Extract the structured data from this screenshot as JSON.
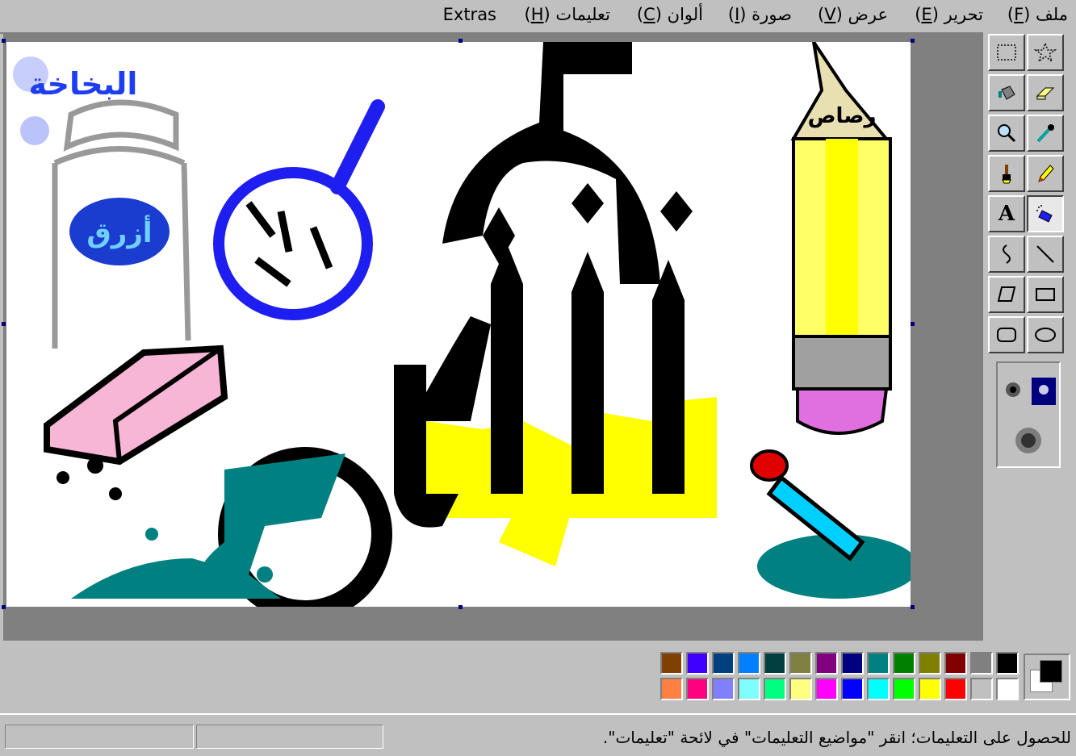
{
  "menubar": {
    "items": [
      {
        "label": "ملف",
        "mnemonic": "F"
      },
      {
        "label": "تحرير",
        "mnemonic": "E"
      },
      {
        "label": "عرض",
        "mnemonic": "V"
      },
      {
        "label": "صورة",
        "mnemonic": "I"
      },
      {
        "label": "ألوان",
        "mnemonic": "C"
      },
      {
        "label": "تعليمات",
        "mnemonic": "H"
      },
      {
        "label": "Extras",
        "mnemonic": ""
      }
    ]
  },
  "canvas": {
    "calligraphy": {
      "top_left": "البخاخة",
      "spray_can_label": "أزرق",
      "pencil_tip": "رصاص"
    }
  },
  "toolbox": {
    "tools": [
      {
        "name": "free-form-select",
        "icon": "star-select-icon"
      },
      {
        "name": "rect-select",
        "icon": "rect-select-icon"
      },
      {
        "name": "eraser",
        "icon": "eraser-icon"
      },
      {
        "name": "fill",
        "icon": "paint-bucket-icon"
      },
      {
        "name": "pick-color",
        "icon": "eyedropper-icon"
      },
      {
        "name": "magnifier",
        "icon": "magnifier-icon"
      },
      {
        "name": "pencil",
        "icon": "pencil-icon"
      },
      {
        "name": "brush",
        "icon": "brush-icon"
      },
      {
        "name": "airbrush",
        "icon": "airbrush-icon",
        "active": true
      },
      {
        "name": "text",
        "icon": "text-icon"
      },
      {
        "name": "line",
        "icon": "line-icon"
      },
      {
        "name": "curve",
        "icon": "curve-icon"
      },
      {
        "name": "rectangle",
        "icon": "rectangle-icon"
      },
      {
        "name": "polygon",
        "icon": "polygon-icon"
      },
      {
        "name": "ellipse",
        "icon": "ellipse-icon"
      },
      {
        "name": "rounded-rectangle",
        "icon": "rounded-rect-icon"
      }
    ],
    "text_tool_glyph": "A"
  },
  "palette": {
    "top_row": [
      "#000000",
      "#808080",
      "#800000",
      "#808000",
      "#008000",
      "#008080",
      "#000080",
      "#800080",
      "#808040",
      "#004040",
      "#0080ff",
      "#004080",
      "#4000ff",
      "#804000"
    ],
    "bottom_row": [
      "#ffffff",
      "#c0c0c0",
      "#ff0000",
      "#ffff00",
      "#00ff00",
      "#00ffff",
      "#0000ff",
      "#ff00ff",
      "#ffff80",
      "#00ff80",
      "#80ffff",
      "#8080ff",
      "#ff0080",
      "#ff8040"
    ],
    "foreground": "#000000",
    "background": "#ffffff"
  },
  "statusbar": {
    "help_text": "للحصول على التعليمات؛ انقر \"مواضيع التعليمات\" في لائحة \"تعليمات\"."
  }
}
